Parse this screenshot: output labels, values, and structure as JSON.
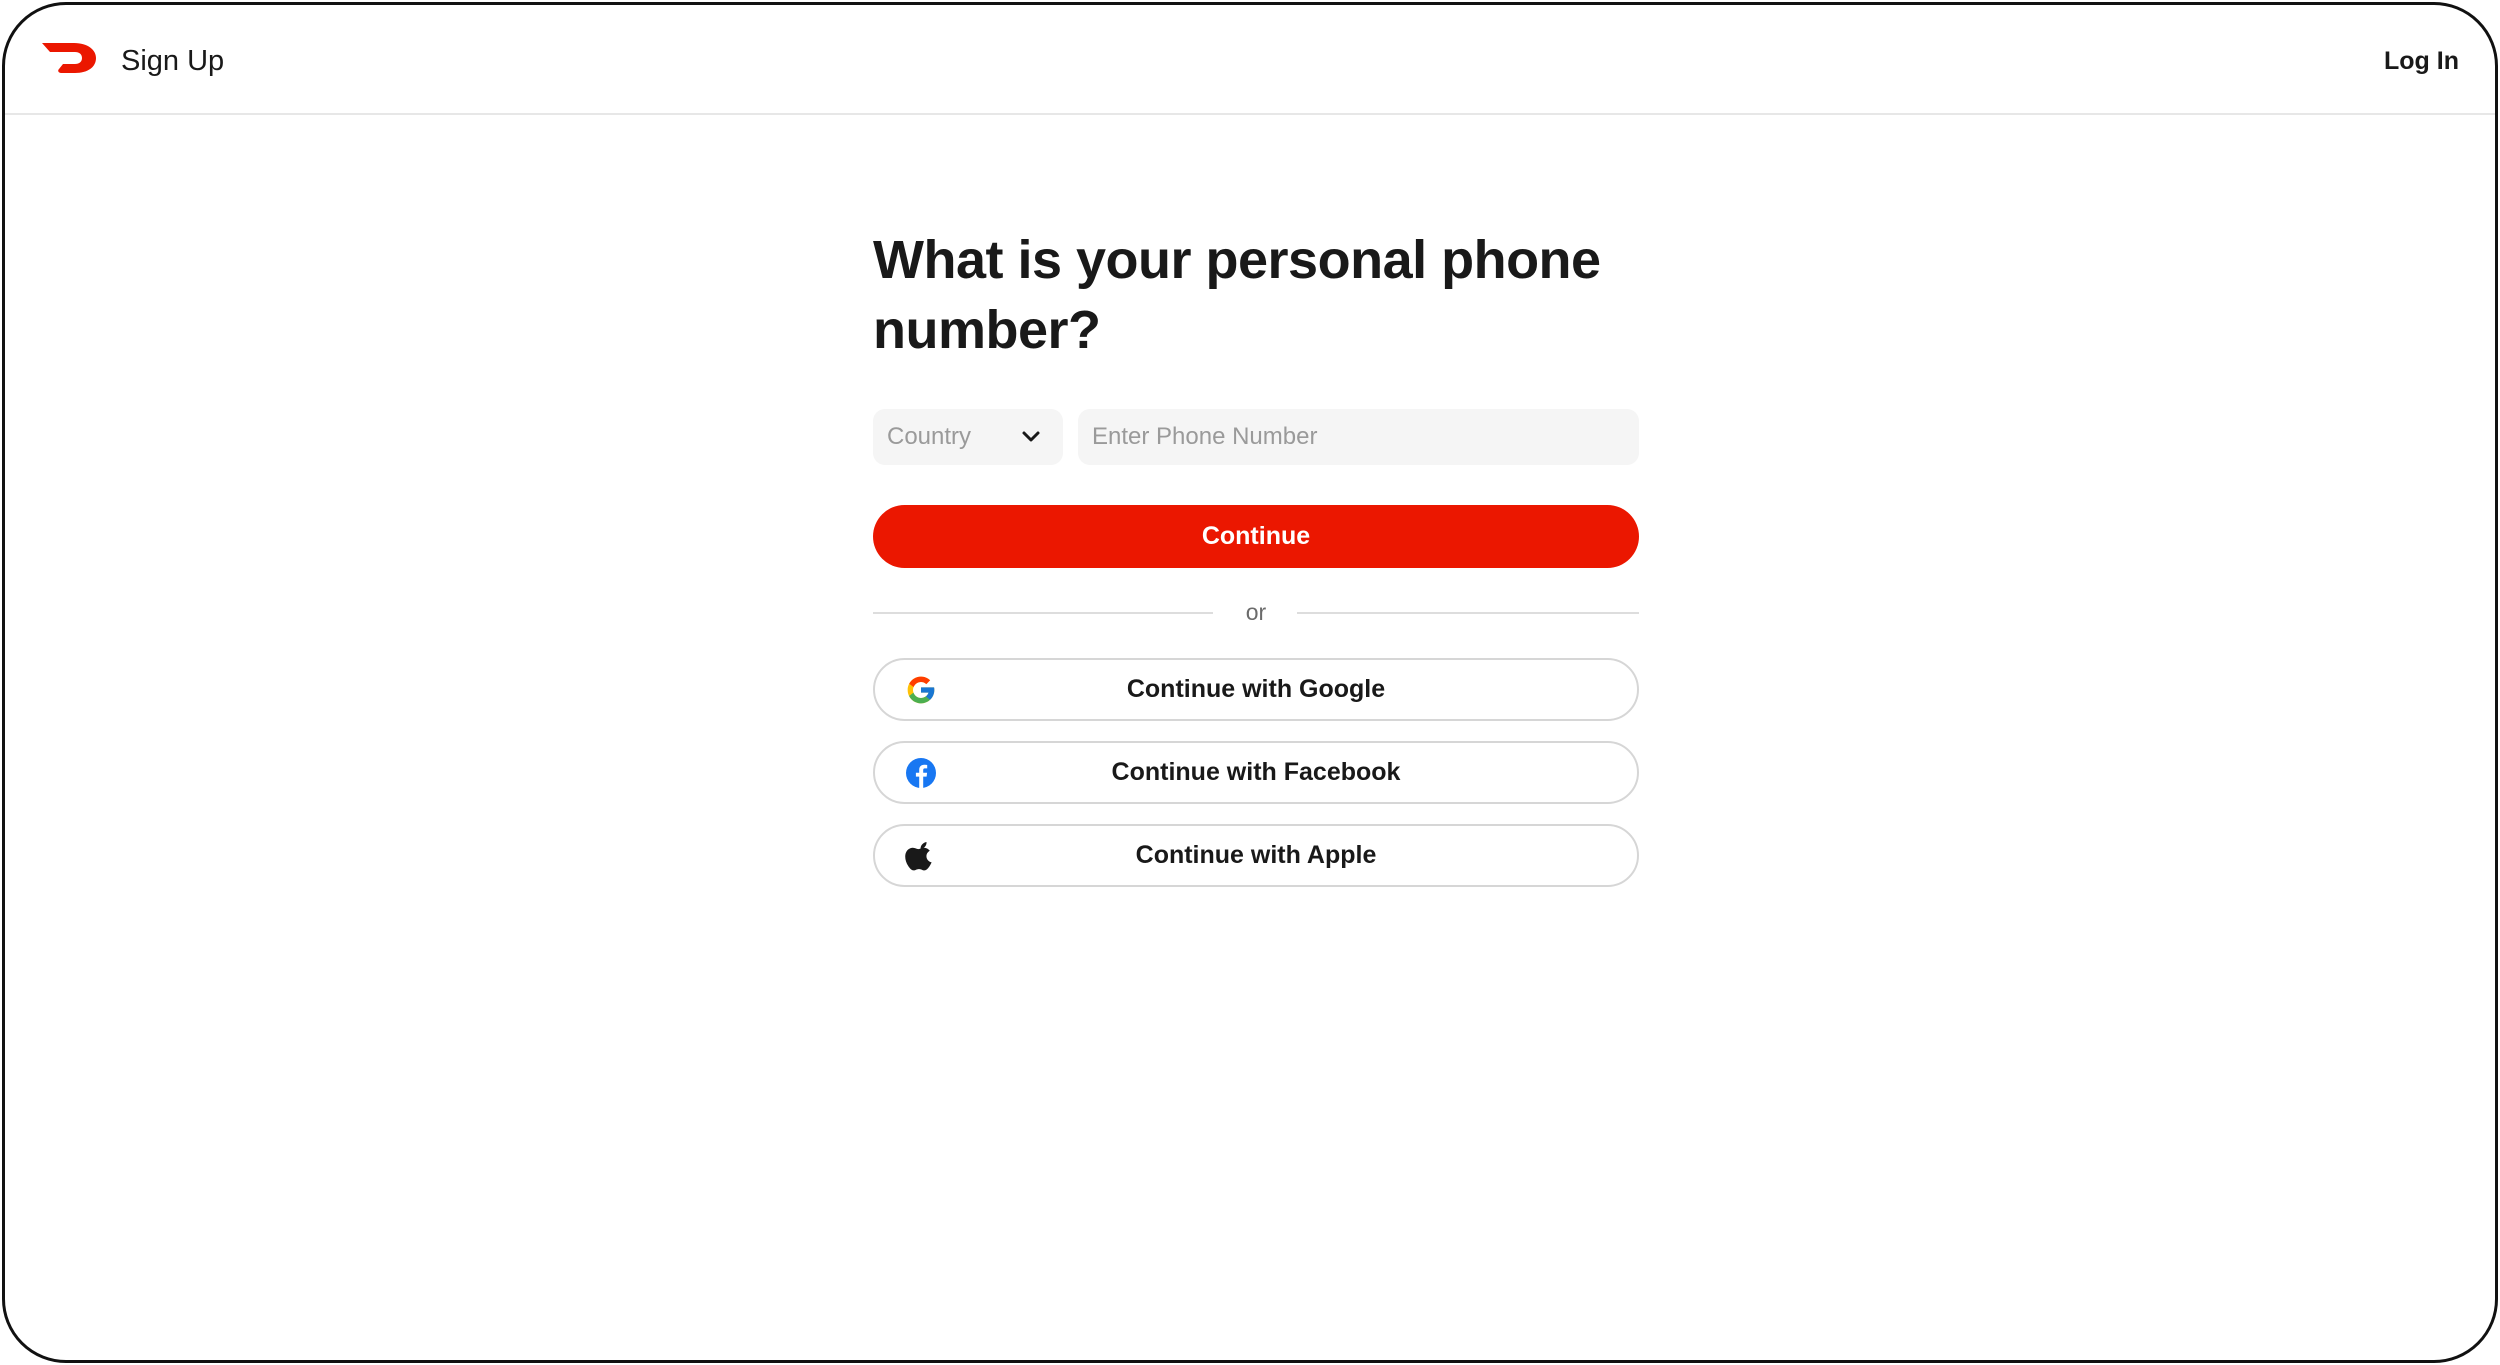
{
  "header": {
    "title": "Sign Up",
    "login_label": "Log In",
    "logo_icon": "doordash-logo-icon",
    "brand_color": "#eb1700"
  },
  "main": {
    "title": "What is your personal phone number?",
    "country": {
      "placeholder": "Country",
      "icon": "chevron-down-icon"
    },
    "phone": {
      "placeholder": "Enter Phone Number",
      "value": ""
    },
    "continue_label": "Continue",
    "divider_text": "or",
    "social": {
      "google_label": "Continue with Google",
      "facebook_label": "Continue with Facebook",
      "apple_label": "Continue with Apple",
      "google_icon": "google-icon",
      "facebook_icon": "facebook-icon",
      "apple_icon": "apple-icon"
    }
  },
  "colors": {
    "primary": "#eb1700",
    "input_bg": "#f5f5f5",
    "placeholder": "#9a9a9a",
    "text": "#191919",
    "border": "#d6d6d6",
    "facebook_blue": "#1877f2"
  }
}
